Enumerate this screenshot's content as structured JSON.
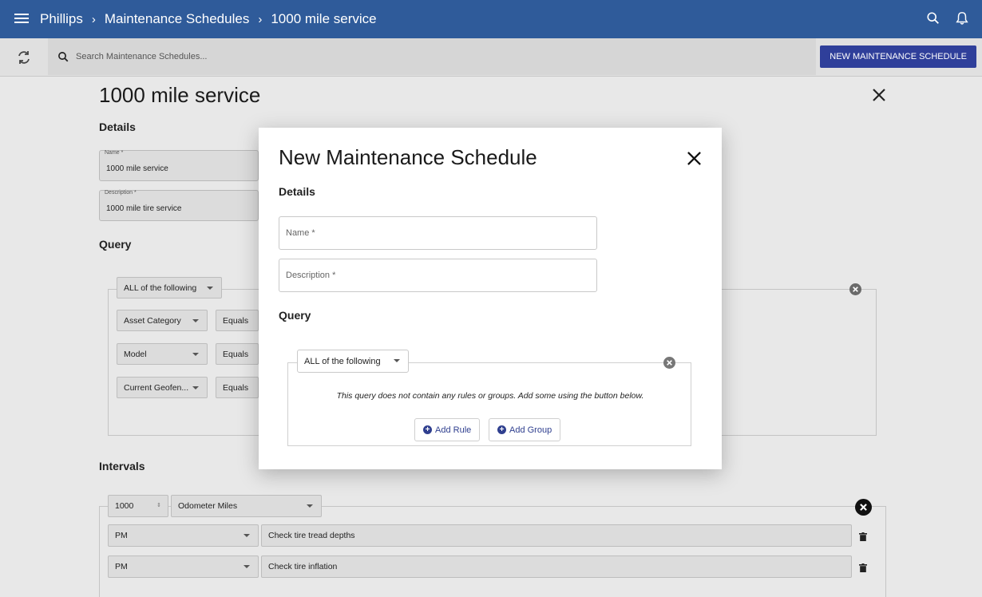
{
  "appbar": {
    "breadcrumbs": [
      "Phillips",
      "Maintenance Schedules",
      "1000 mile service"
    ],
    "separator": "›"
  },
  "toolbar": {
    "search_placeholder": "Search Maintenance Schedules...",
    "new_button_label": "NEW MAINTENANCE SCHEDULE"
  },
  "page": {
    "title": "1000 mile service",
    "details_heading": "Details",
    "name_field": {
      "label": "Name *",
      "value": "1000 mile service"
    },
    "description_field": {
      "label": "Description *",
      "value": "1000 mile tire service"
    },
    "query_heading": "Query",
    "query": {
      "combinator": "ALL of the following",
      "rules": [
        {
          "field": "Asset Category",
          "operator": "Equals"
        },
        {
          "field": "Model",
          "operator": "Equals"
        },
        {
          "field": "Current Geofen...",
          "operator": "Equals"
        }
      ]
    },
    "intervals_heading": "Intervals",
    "interval": {
      "value": "1000",
      "unit": "Odometer Miles",
      "tasks": [
        {
          "type": "PM",
          "description": "Check tire tread depths"
        },
        {
          "type": "PM",
          "description": "Check tire inflation"
        }
      ]
    }
  },
  "modal": {
    "title": "New Maintenance Schedule",
    "details_heading": "Details",
    "name_placeholder": "Name *",
    "description_placeholder": "Description *",
    "query_heading": "Query",
    "combinator": "ALL of the following",
    "empty_message": "This query does not contain any rules or groups. Add some using the button below.",
    "add_rule_label": "Add Rule",
    "add_group_label": "Add Group"
  },
  "colors": {
    "appbar": "#2f5b9a",
    "primary_button": "#2f3f9a",
    "link": "#2f3f8f"
  }
}
